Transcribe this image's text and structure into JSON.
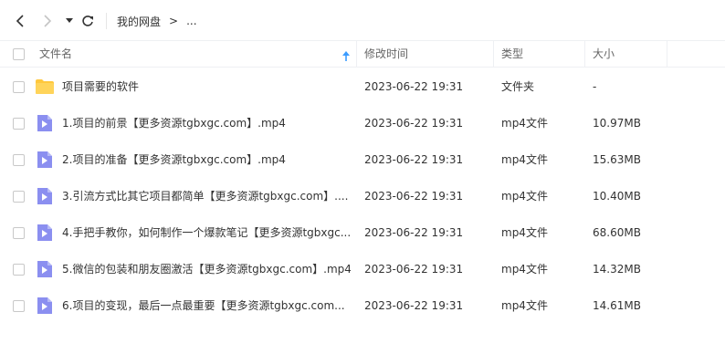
{
  "toolbar": {
    "back_icon": "chevron-left-icon",
    "forward_icon": "chevron-right-icon",
    "dropdown_icon": "caret-down-icon",
    "refresh_icon": "refresh-icon",
    "breadcrumb": [
      "我的网盘",
      ">",
      "..."
    ]
  },
  "header": {
    "name": "文件名",
    "sort_icon": "sort-arrow-up-icon",
    "modified": "修改时间",
    "type": "类型",
    "size": "大小"
  },
  "colors": {
    "folder": "#ffc83d",
    "video": "#8b8ff0",
    "sort_arrow": "#3b9cff"
  },
  "files": [
    {
      "name": "项目需要的软件",
      "time": "2023-06-22 19:31",
      "type": "文件夹",
      "size": "-",
      "icon": "folder-icon"
    },
    {
      "name": "1.项目的前景【更多资源tgbxgc.com】.mp4",
      "time": "2023-06-22 19:31",
      "type": "mp4文件",
      "size": "10.97MB",
      "icon": "video-file-icon"
    },
    {
      "name": "2.项目的准备【更多资源tgbxgc.com】.mp4",
      "time": "2023-06-22 19:31",
      "type": "mp4文件",
      "size": "15.63MB",
      "icon": "video-file-icon"
    },
    {
      "name": "3.引流方式比其它项目都简单【更多资源tgbxgc.com】....",
      "time": "2023-06-22 19:31",
      "type": "mp4文件",
      "size": "10.40MB",
      "icon": "video-file-icon"
    },
    {
      "name": "4.手把手教你，如何制作一个爆款笔记【更多资源tgbxgc...",
      "time": "2023-06-22 19:31",
      "type": "mp4文件",
      "size": "68.60MB",
      "icon": "video-file-icon"
    },
    {
      "name": "5.微信的包装和朋友圈激活【更多资源tgbxgc.com】.mp4",
      "time": "2023-06-22 19:31",
      "type": "mp4文件",
      "size": "14.32MB",
      "icon": "video-file-icon"
    },
    {
      "name": "6.项目的变现，最后一点最重要【更多资源tgbxgc.com...",
      "time": "2023-06-22 19:31",
      "type": "mp4文件",
      "size": "14.61MB",
      "icon": "video-file-icon"
    }
  ]
}
